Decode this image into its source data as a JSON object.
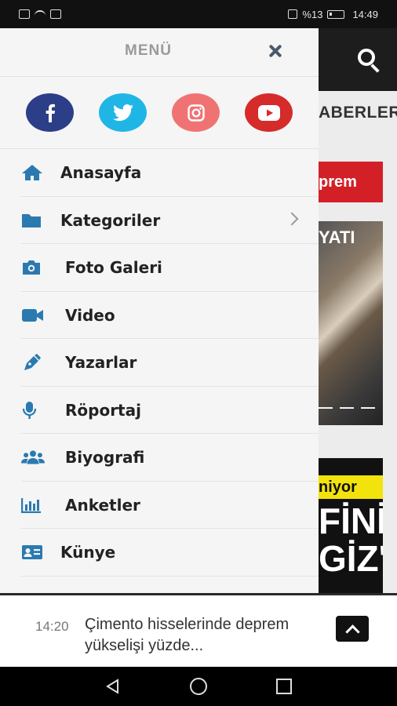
{
  "status_bar": {
    "battery": "%13",
    "time": "14:49"
  },
  "background": {
    "tab_label": "ABERLER",
    "red_button": "prem",
    "image1_text": "YATI",
    "image1_dashes": "— — —",
    "image2_banner": "niyor",
    "image2_big": "FİNİ\nGİZ'"
  },
  "drawer": {
    "title": "MENÜ",
    "socials": [
      {
        "name": "facebook",
        "color": "#2c3e87"
      },
      {
        "name": "twitter",
        "color": "#1fb6e6"
      },
      {
        "name": "instagram",
        "color": "#f07373"
      },
      {
        "name": "youtube",
        "color": "#d52b2b"
      }
    ],
    "items": [
      {
        "label": "Anasayfa",
        "icon": "home-icon"
      },
      {
        "label": "Kategoriler",
        "icon": "folder-icon"
      },
      {
        "label": "Foto Galeri",
        "icon": "camera-icon"
      },
      {
        "label": "Video",
        "icon": "video-icon"
      },
      {
        "label": "Yazarlar",
        "icon": "pen-icon"
      },
      {
        "label": "Röportaj",
        "icon": "microphone-icon"
      },
      {
        "label": "Biyografi",
        "icon": "users-icon"
      },
      {
        "label": "Anketler",
        "icon": "chart-icon"
      },
      {
        "label": "Künye",
        "icon": "id-card-icon"
      }
    ]
  },
  "notification": {
    "time": "14:20",
    "text": "Çimento hisselerinde deprem yükselişi yüzde..."
  },
  "colors": {
    "icon_blue": "#2a7ab0",
    "drawer_bg": "#f5f5f5"
  }
}
